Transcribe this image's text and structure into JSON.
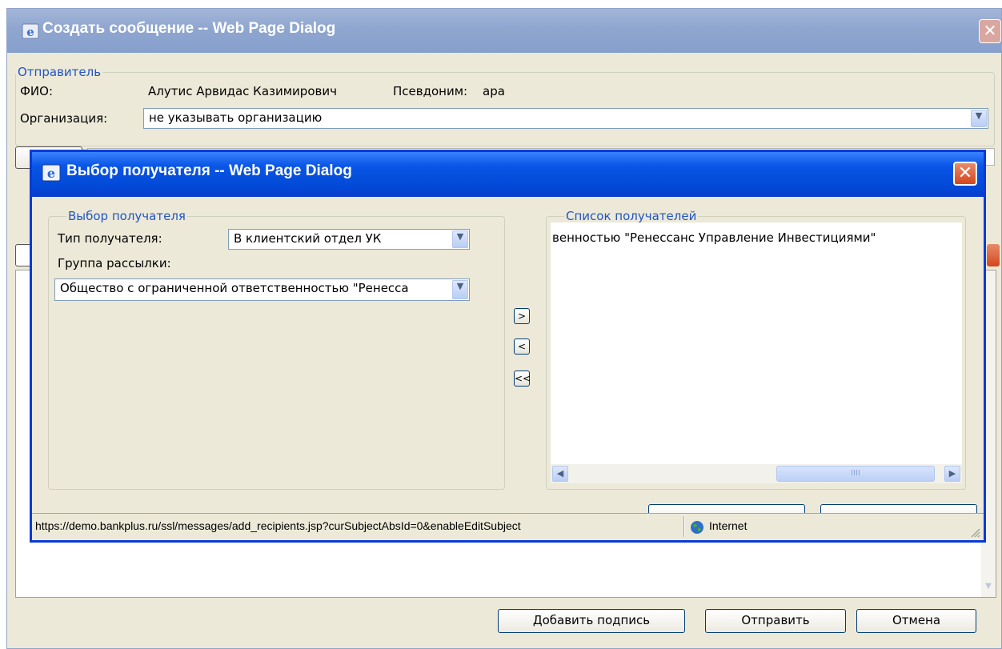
{
  "outer_dialog": {
    "title": "Создать сообщение -- Web Page Dialog",
    "sender": {
      "legend": "Отправитель",
      "fio_label": "ФИО:",
      "fio_value": "Алутис Арвидас Казимирович",
      "alias_label": "Псевдоним:",
      "alias_value": "ара",
      "org_label": "Организация:",
      "org_value": "не указывать организацию"
    },
    "buttons": {
      "add_signature": "Добавить подпись",
      "send": "Отправить",
      "cancel": "Отмена"
    }
  },
  "inner_dialog": {
    "title": "Выбор получателя -- Web Page Dialog",
    "selection": {
      "legend": "Выбор получателя",
      "type_label": "Тип получателя:",
      "type_value": "В клиентский отдел УК",
      "group_label": "Группа рассылки:",
      "group_value": "Общество с ограниченной ответственностью \"Ренесса"
    },
    "recipients": {
      "legend": "Список получателей",
      "items": [
        "венностью \"Ренессанс Управление Инвестициями\""
      ]
    },
    "move_buttons": {
      "add": ">",
      "remove": "<",
      "remove_all": "<<"
    },
    "status": {
      "url": "https://demo.bankplus.ru/ssl/messages/add_recipients.jsp?curSubjectAbsId=0&enableEditSubject",
      "zone": "Internet"
    }
  },
  "colors": {
    "inner_title_blue": "#0a56e6",
    "outer_title_blue": "#8fa6cf",
    "legend_blue": "#2155c4",
    "dialog_face": "#ece9d8"
  }
}
